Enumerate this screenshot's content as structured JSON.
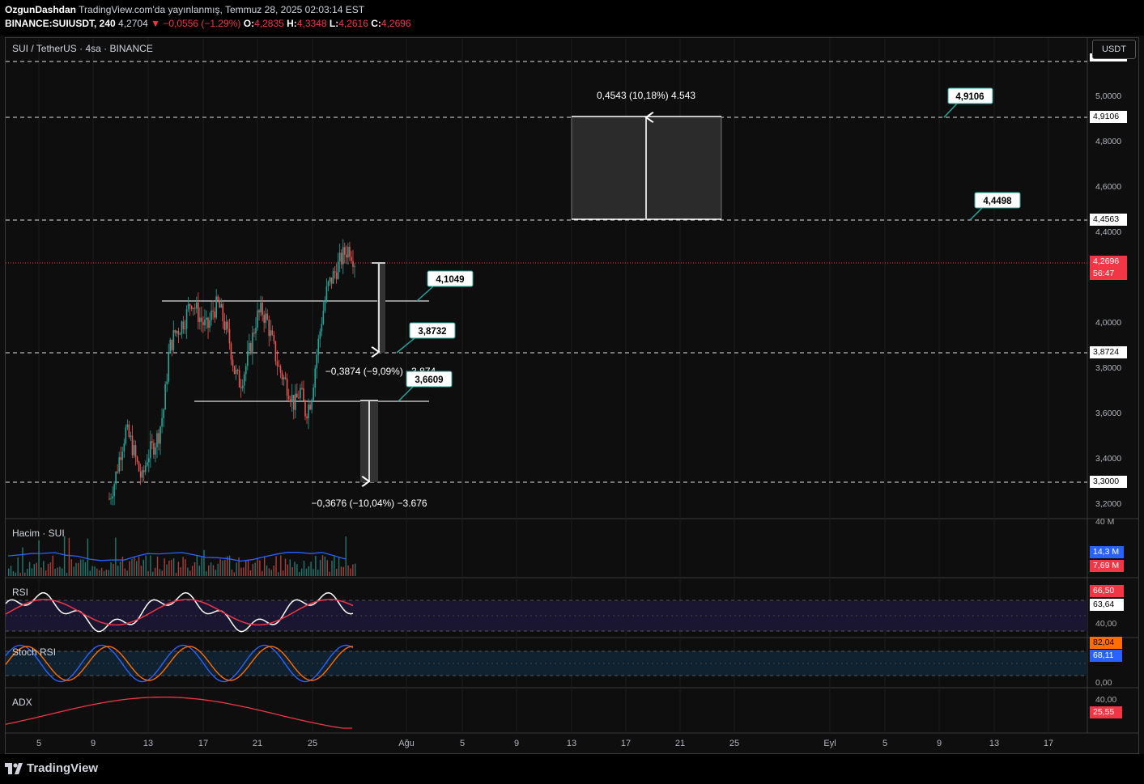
{
  "header": {
    "author": "OzgunDashdan",
    "published": "TradingView.com'da yayınlanmış, Temmuz 28, 2025 02:03:14 EST",
    "symbol": "BINANCE:SUIUSDT, 240",
    "last": "4,2704",
    "change": "−0,0556 (−1.29%)",
    "o_label": "O:",
    "o_val": "4,2835",
    "h_label": "H:",
    "h_val": "4,3348",
    "l_label": "L:",
    "l_val": "4,2616",
    "c_label": "C:",
    "c_val": "4,2696"
  },
  "pane_title": "SUI / TetherUS · 4sa · BINANCE",
  "currency_button": "USDT",
  "indicators": {
    "volume": "Hacim · SUI",
    "rsi": "RSI",
    "stoch": "Stoch RSI",
    "adx": "ADX"
  },
  "footer": {
    "brand": "TradingView"
  },
  "colors": {
    "up": "#26a69a",
    "down": "#ef5350",
    "rsi": "#ffffff",
    "rsi_ma": "#f23645",
    "k": "#2962ff",
    "d": "#ff6d00",
    "adx": "#f23645"
  },
  "chart_data": {
    "type": "candlestick",
    "x_ticks": [
      "5",
      "9",
      "13",
      "17",
      "21",
      "25",
      "Ağu",
      "5",
      "9",
      "13",
      "17",
      "21",
      "25",
      "Eyl",
      "5",
      "9",
      "13",
      "17"
    ],
    "y_ticks": [
      "5,0000",
      "4,8000",
      "4,6000",
      "4,4000",
      "4,0000",
      "3,8000",
      "3,6000",
      "3,4000",
      "3,2000"
    ],
    "price_lines": [
      {
        "value": "4,9106",
        "label": "4,9106"
      },
      {
        "value": "4,4563",
        "label": "4,4563"
      },
      {
        "value": "3,8724",
        "label": "3,8724"
      },
      {
        "value": "3,3000",
        "label": "3,3000"
      }
    ],
    "current_price": {
      "value": "4,2696",
      "countdown": "56:47"
    },
    "callouts": [
      "4,9106",
      "4,4498",
      "4,1049",
      "3,8732",
      "3,6609"
    ],
    "measures": [
      {
        "text": "0,4543 (10,18%) 4.543"
      },
      {
        "text": "−0,3874 (−9,09%) −3.874"
      },
      {
        "text": "−0,3676 (−10,04%) −3.676"
      }
    ],
    "volume_axis": {
      "top": "40 M",
      "values": [
        "14,3 M",
        "7,69 M"
      ]
    },
    "rsi_axis": {
      "values": [
        "66,50",
        "63,64"
      ],
      "tick": "40,00"
    },
    "stoch_axis": {
      "values": [
        "82,04",
        "68,11"
      ],
      "tick": "0,00"
    },
    "adx_axis": {
      "tick": "40,00",
      "value": "25,55"
    },
    "close_series": [
      3.22,
      3.3,
      3.42,
      3.52,
      3.47,
      3.38,
      3.3,
      3.41,
      3.45,
      3.5,
      3.62,
      3.88,
      3.95,
      3.98,
      4.02,
      4.1,
      4.05,
      4.0,
      3.97,
      4.05,
      4.08,
      4.0,
      3.92,
      3.78,
      3.73,
      3.8,
      3.9,
      4.02,
      4.05,
      4.0,
      3.9,
      3.8,
      3.75,
      3.7,
      3.63,
      3.7,
      3.6,
      3.66,
      3.85,
      4.02,
      4.15,
      4.2,
      4.25,
      4.3,
      4.33,
      4.27
    ]
  }
}
